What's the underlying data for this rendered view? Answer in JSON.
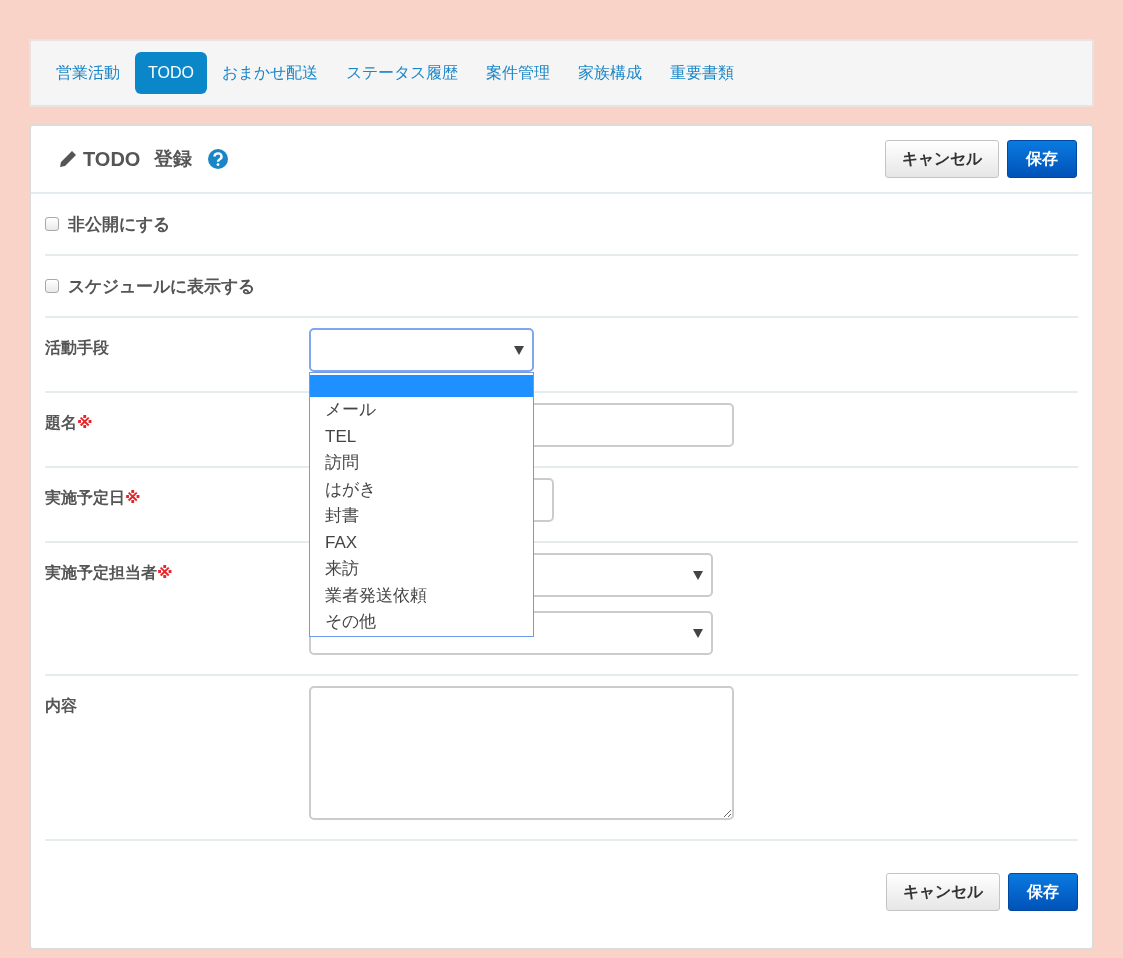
{
  "tabs": [
    {
      "label": "営業活動",
      "selected": false
    },
    {
      "label": "TODO",
      "selected": true
    },
    {
      "label": "おまかせ配送",
      "selected": false
    },
    {
      "label": "ステータス履歴",
      "selected": false
    },
    {
      "label": "案件管理",
      "selected": false
    },
    {
      "label": "家族構成",
      "selected": false
    },
    {
      "label": "重要書類",
      "selected": false
    }
  ],
  "panel": {
    "title": "TODO",
    "subtitle": "登録",
    "cancel_button": "キャンセル",
    "save_button": "保存"
  },
  "checkboxes": [
    {
      "label": "非公開にする",
      "checked": false
    },
    {
      "label": "スケジュールに表示する",
      "checked": false
    }
  ],
  "fields": [
    {
      "label": "活動手段",
      "kind": "select",
      "focused": true
    },
    {
      "label": "題名",
      "mark": "※",
      "kind": "text"
    },
    {
      "label": "実施予定日",
      "mark": "※",
      "kind": "date"
    },
    {
      "label": "実施予定担当者",
      "mark": "※",
      "kind": "select_pair"
    },
    {
      "label": "内容",
      "kind": "textarea"
    }
  ],
  "dropdown": {
    "blank_option_highlighted": true,
    "options": [
      "メール",
      "TEL",
      "訪問",
      "はがき",
      "封書",
      "FAX",
      "来訪",
      "業者発送依頼",
      "その他"
    ]
  },
  "footer": {
    "cancel_button": "キャンセル",
    "save_button": "保存"
  }
}
